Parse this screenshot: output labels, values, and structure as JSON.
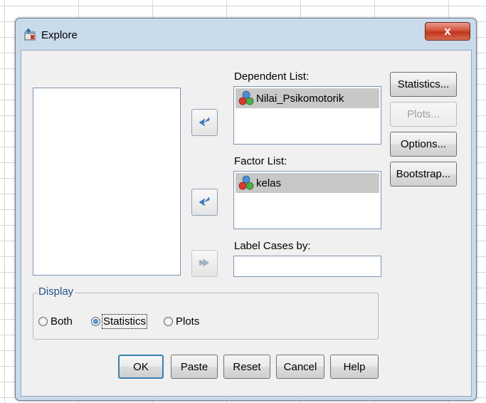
{
  "window": {
    "title": "Explore",
    "close_label": "x"
  },
  "source_list": {
    "items": []
  },
  "dependent_list": {
    "label": "Dependent List:",
    "items": [
      "Nilai_Psikomotorik"
    ]
  },
  "factor_list": {
    "label": "Factor List:",
    "items": [
      "kelas"
    ]
  },
  "label_cases": {
    "label": "Label Cases by:",
    "value": ""
  },
  "side_buttons": {
    "statistics": "Statistics...",
    "plots": "Plots...",
    "options": "Options...",
    "bootstrap": "Bootstrap..."
  },
  "display": {
    "legend": "Display",
    "options": [
      "Both",
      "Statistics",
      "Plots"
    ],
    "selected": "Statistics"
  },
  "bottom_buttons": {
    "ok": "OK",
    "paste": "Paste",
    "reset": "Reset",
    "cancel": "Cancel",
    "help": "Help"
  },
  "colors": {
    "accent": "#1f6ab2",
    "title_bar": "#c9daea",
    "selection": "#c8c8c8",
    "close": "#c2331c"
  },
  "icons": {
    "title": "spss-explore-icon",
    "variable": "nominal-variable-icon",
    "move": "arrow-left-icon",
    "move_disabled": "arrow-right-icon"
  }
}
